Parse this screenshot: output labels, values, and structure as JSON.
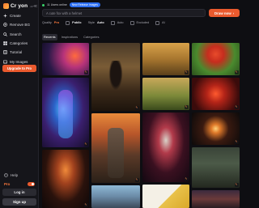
{
  "app": {
    "name": "Cr  yon",
    "sub": "v3"
  },
  "sidebar": {
    "items": [
      {
        "label": "Create",
        "icon": "sparkle-icon"
      },
      {
        "label": "Remove BG",
        "icon": "remove-bg-icon"
      },
      {
        "label": "Search",
        "icon": "search-icon"
      },
      {
        "label": "Categories",
        "icon": "grid-icon"
      },
      {
        "label": "Tutorial",
        "icon": "book-icon"
      },
      {
        "label": "My Images",
        "icon": "image-icon"
      }
    ],
    "upgrade_label": "Upgrade to Pro",
    "help_label": "Help",
    "plan_label": "Pro",
    "login_label": "Log in",
    "signup_label": "Sign up"
  },
  "topbar": {
    "online": "11 Users online",
    "badge": "New Release Images"
  },
  "search": {
    "placeholder": "A cute fox with a helmet",
    "button_label": "Draw now"
  },
  "options": {
    "quality_label": "Quality",
    "quality_value": "Pro",
    "visibility_value": "Public",
    "style_label": "Style",
    "style_value": "Auto",
    "auto_label": "Auto",
    "excluded_label": "Excluded",
    "ai_label": "AI"
  },
  "tabs": [
    "Recents",
    "Inspirations",
    "Categories"
  ],
  "colors": {
    "accent": "#ea5a2e",
    "background": "#0e0e12",
    "sidebar": "#15151a"
  },
  "gallery_tiles": [
    {
      "name": "tile-neon-city"
    },
    {
      "name": "tile-skeleton-rider"
    },
    {
      "name": "tile-tropical-village"
    },
    {
      "name": "tile-red-dancer"
    },
    {
      "name": "tile-cyber-warrior"
    },
    {
      "name": "tile-autumn-dog"
    },
    {
      "name": "tile-flower-portrait"
    },
    {
      "name": "tile-sunset-hills"
    },
    {
      "name": "tile-knight-sunset"
    },
    {
      "name": "tile-calavera-queen"
    },
    {
      "name": "tile-fireworks"
    },
    {
      "name": "tile-skull-costume"
    },
    {
      "name": "tile-armored-knight"
    },
    {
      "name": "tile-pagoda-crowd"
    },
    {
      "name": "tile-sky-portrait"
    },
    {
      "name": "tile-gold-arrow"
    }
  ]
}
